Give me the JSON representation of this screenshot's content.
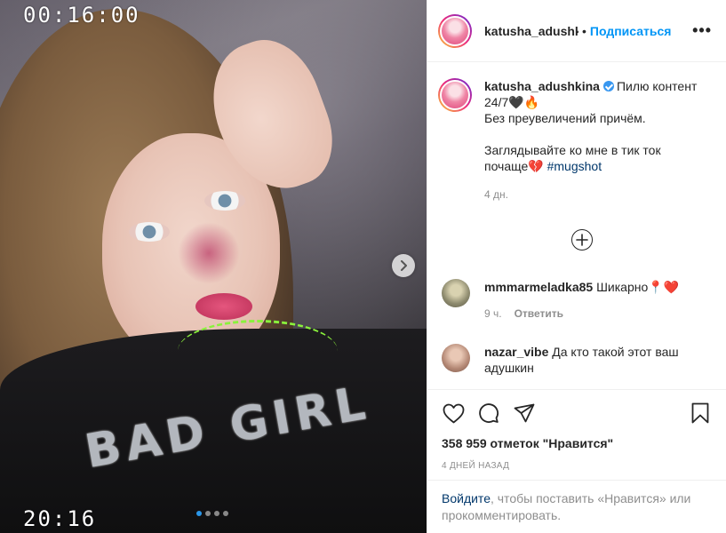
{
  "photo": {
    "timestamp_top": "00:16:00",
    "timestamp_bottom": "20:16",
    "shirt_text": "BAD GIRL",
    "carousel_total": 4,
    "carousel_active": 1,
    "dot_active_color": "#2a96e8"
  },
  "header": {
    "username": "katusha_adushkina",
    "separator": "•",
    "follow_label": "Подписаться",
    "more_label": "•••"
  },
  "post": {
    "username": "katusha_adushkina",
    "caption_line1": "Пилю контент 24/7🖤🔥",
    "caption_line2": "Без преувеличений причём.",
    "caption_line3": "Заглядывайте ко мне в тик ток почаще💔",
    "hashtag": "#mugshot",
    "time": "4 дн."
  },
  "comments": [
    {
      "username": "mmmarmeladka85",
      "text": "Шикарно📍❤️",
      "time": "9 ч.",
      "reply": "Ответить"
    },
    {
      "username": "nazar_vibe",
      "text": "Да кто такой этот ваш адушкин"
    }
  ],
  "actions": {
    "likes": "358 959 отметок \"Нравится\"",
    "date": "4 ДНЕЙ НАЗАД"
  },
  "login": {
    "link": "Войдите",
    "text": ", чтобы поставить «Нравится» или прокомментировать."
  },
  "colors": {
    "accent": "#0095f6",
    "link_dark": "#00376b",
    "muted": "#8e8e8e"
  }
}
